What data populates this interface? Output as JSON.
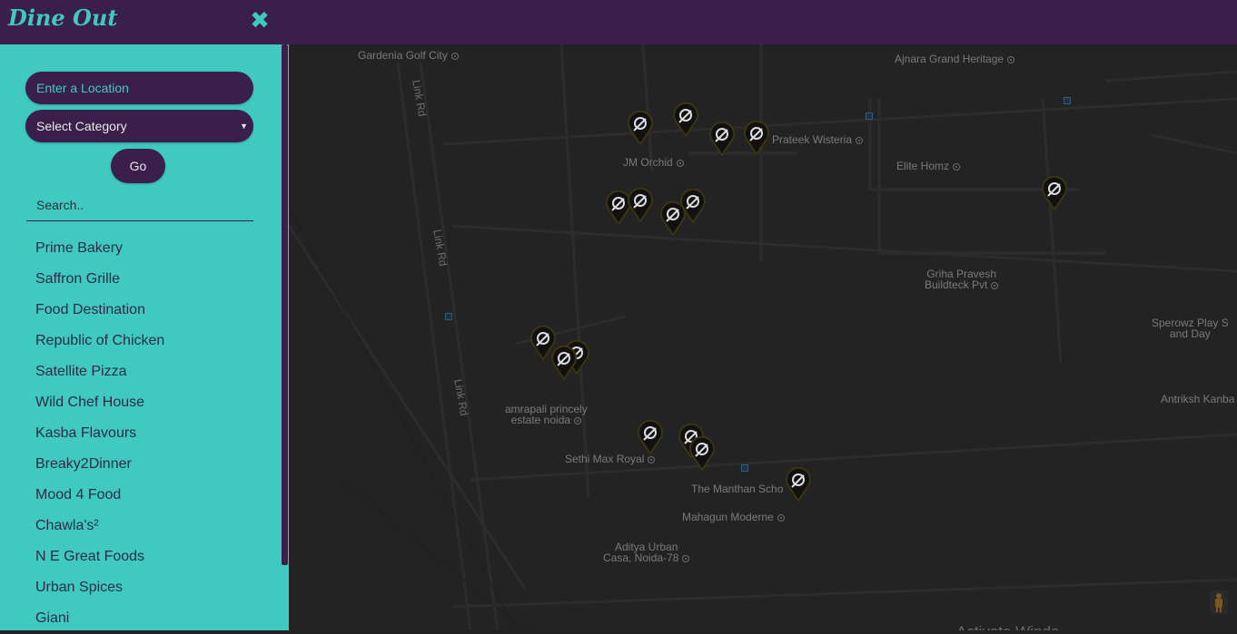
{
  "sidebar": {
    "brand": "Dine Out",
    "close_label": "✖",
    "location_placeholder": "Enter a Location",
    "category_selected": "Select Category",
    "go_label": "Go",
    "search_placeholder": "Search..",
    "restaurants": [
      "Prime Bakery",
      "Saffron Grille",
      "Food Destination",
      "Republic of Chicken",
      "Satellite Pizza",
      "Wild Chef House",
      "Kasba Flavours",
      "Breaky2Dinner",
      "Mood 4 Food",
      "Chawla's²",
      "N E Great Foods",
      "Urban Spices",
      "Giani"
    ]
  },
  "map": {
    "places": {
      "gardenia": "Gardenia Golf City",
      "ajnara": "Ajnara Grand Heritage",
      "prateek": "Prateek Wisteria",
      "jm_orchid": "JM Orchid",
      "elite": "Elite Homz",
      "griha_1": "Griha Pravesh",
      "griha_2": "Buildteck Pvt",
      "sperowz_1": "Sperowz Play S",
      "sperowz_2": "and Day",
      "antriksh": "Antriksh Kanba",
      "amrapali_1": "amrapali princely",
      "amrapali_2": "estate noida",
      "sethi": "Sethi Max Royal",
      "manthan": "The Manthan Scho",
      "mahagun": "Mahagun Moderne",
      "aditya_1": "Aditya Urban",
      "aditya_2": "Casa, Noida-78"
    },
    "roads": {
      "link_rd": "Link Rd"
    },
    "watermark": "Activate Windo"
  },
  "colors": {
    "header": "#3a1f4b",
    "sidebar": "#40c9c1",
    "map_bg": "#232323"
  }
}
